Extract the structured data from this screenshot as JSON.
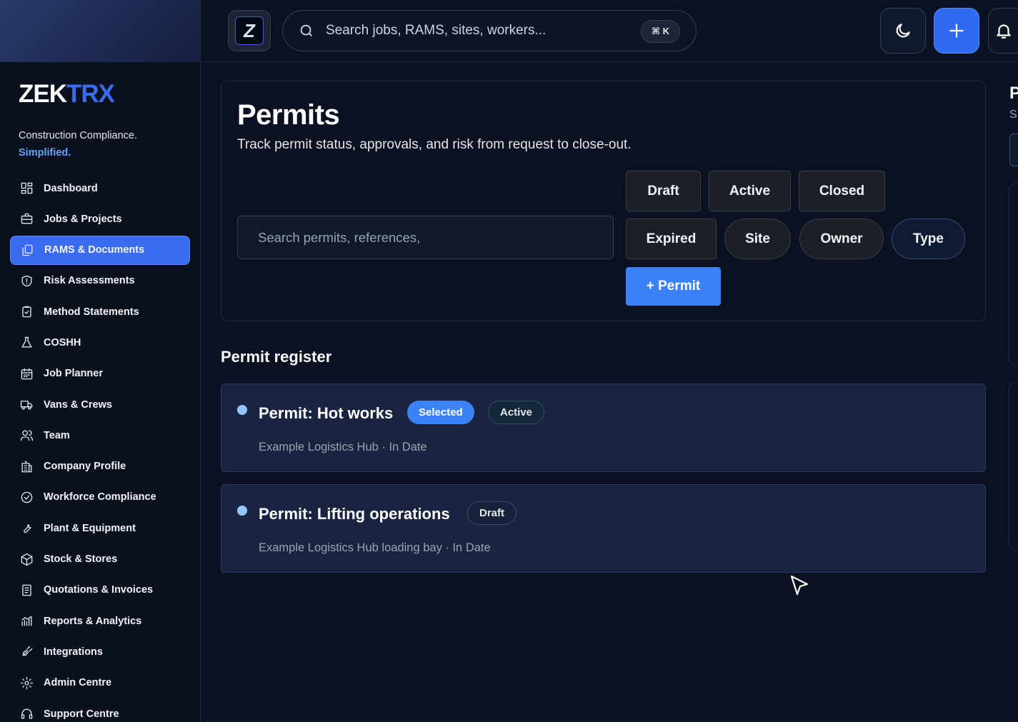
{
  "sidebar": {
    "brand_main": "ZEK",
    "brand_accent": "TRX",
    "tagline": "Construction Compliance.",
    "tagline_highlight": "Simplified.",
    "items": [
      {
        "label": "Dashboard",
        "icon": "dashboard-icon"
      },
      {
        "label": "Jobs & Projects",
        "icon": "briefcase-icon"
      },
      {
        "label": "RAMS & Documents",
        "icon": "documents-icon",
        "active": true
      },
      {
        "label": "Risk Assessments",
        "icon": "shield-icon"
      },
      {
        "label": "Method Statements",
        "icon": "clipboard-check-icon"
      },
      {
        "label": "COSHH",
        "icon": "flask-icon"
      },
      {
        "label": "Job Planner",
        "icon": "calendar-icon"
      },
      {
        "label": "Vans & Crews",
        "icon": "truck-icon"
      },
      {
        "label": "Team",
        "icon": "users-icon"
      },
      {
        "label": "Company Profile",
        "icon": "building-icon"
      },
      {
        "label": "Workforce Compliance",
        "icon": "check-circle-icon"
      },
      {
        "label": "Plant & Equipment",
        "icon": "wrench-icon"
      },
      {
        "label": "Stock & Stores",
        "icon": "box-icon"
      },
      {
        "label": "Quotations & Invoices",
        "icon": "receipt-icon"
      },
      {
        "label": "Reports & Analytics",
        "icon": "chart-icon"
      },
      {
        "label": "Integrations",
        "icon": "plug-icon"
      },
      {
        "label": "Admin Centre",
        "icon": "gear-icon"
      },
      {
        "label": "Support Centre",
        "icon": "headset-icon"
      }
    ]
  },
  "topbar": {
    "logo_letter": "Z",
    "search_placeholder": "Search jobs, RAMS, sites, workers...",
    "shortcut": "⌘ K"
  },
  "permits": {
    "title": "Permits",
    "subtitle": "Track permit status, approvals, and risk from request to close-out.",
    "search_placeholder": "Search permits, references,",
    "filters": {
      "draft": "Draft",
      "active": "Active",
      "closed": "Closed",
      "expired": "Expired",
      "site": "Site",
      "owner": "Owner",
      "type": "Type"
    },
    "add_button": "+ Permit"
  },
  "register": {
    "title": "Permit register",
    "rows": [
      {
        "title": "Permit: Hot works",
        "badges": [
          "Selected",
          "Active"
        ],
        "meta": "Example Logistics Hub · In Date"
      },
      {
        "title": "Permit: Lifting operations",
        "badges": [
          "Draft"
        ],
        "meta": "Example Logistics Hub loading bay · In Date"
      }
    ]
  },
  "right_panel": {
    "letter": "P",
    "sub": "S"
  },
  "colors": {
    "accent": "#3b6cf0",
    "primary_button": "#3b82f6",
    "background": "#0b1120"
  }
}
